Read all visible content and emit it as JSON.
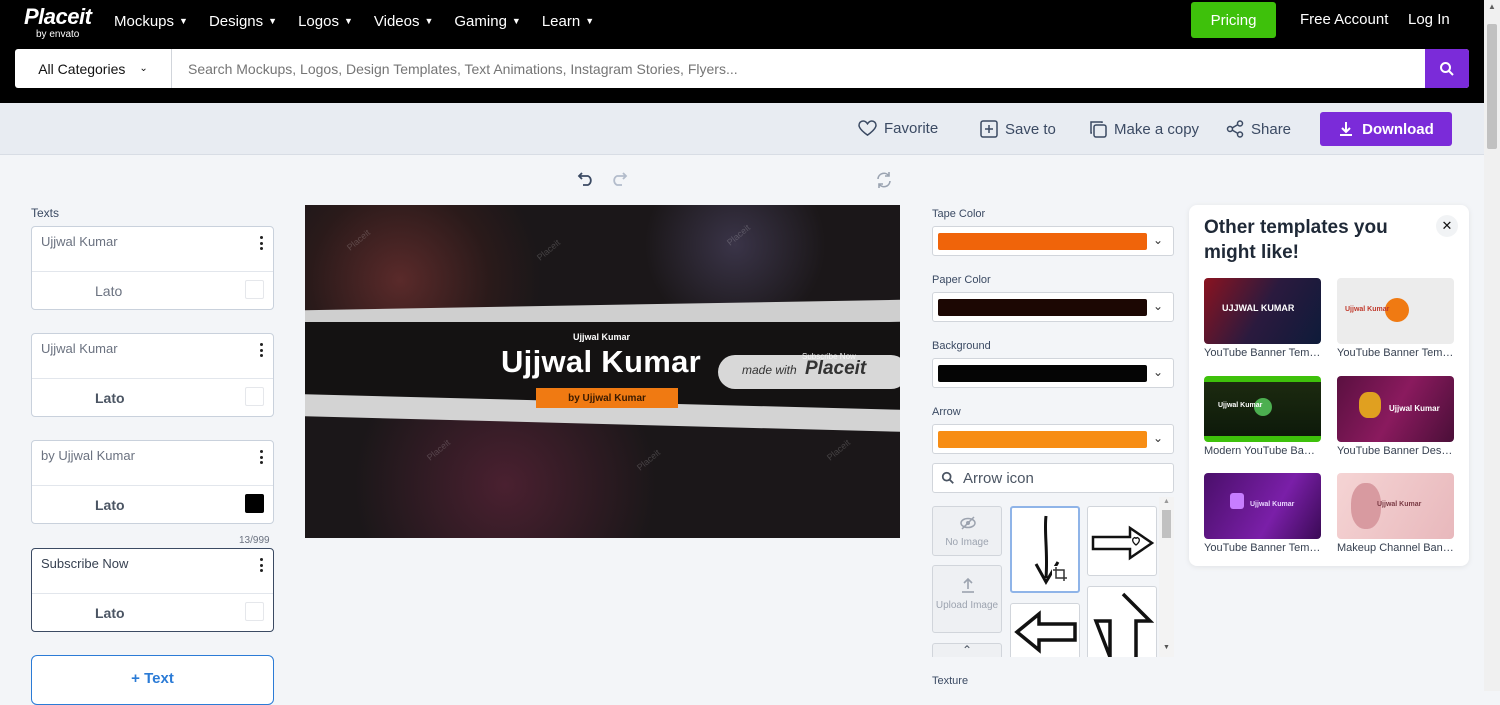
{
  "brand": {
    "name": "Placeit",
    "sub": "by envato"
  },
  "nav": [
    {
      "label": "Mockups"
    },
    {
      "label": "Designs"
    },
    {
      "label": "Logos"
    },
    {
      "label": "Videos"
    },
    {
      "label": "Gaming"
    },
    {
      "label": "Learn"
    }
  ],
  "header": {
    "pricing": "Pricing",
    "free_account": "Free Account",
    "login": "Log In"
  },
  "search": {
    "category": "All Categories",
    "placeholder": "Search Mockups, Logos, Design Templates, Text Animations, Instagram Stories, Flyers..."
  },
  "toolbar": {
    "favorite": "Favorite",
    "save_to": "Save to",
    "make_copy": "Make a copy",
    "share": "Share",
    "download": "Download"
  },
  "texts_panel": {
    "label": "Texts",
    "items": [
      {
        "value": "Ujjwal Kumar",
        "font": "Lato"
      },
      {
        "value": "Ujjwal Kumar",
        "font": "Lato"
      },
      {
        "value": "by Ujjwal Kumar",
        "font": "Lato"
      },
      {
        "value": "Subscribe Now",
        "font": "Lato"
      }
    ],
    "char_count": "13/999",
    "add_text": "+ Text"
  },
  "canvas": {
    "small_title": "Ujjwal Kumar",
    "big_title": "Ujjwal Kumar",
    "tape_text": "by Ujjwal Kumar",
    "subscribe": "Subscribe Now",
    "made_with": "made with",
    "placeit": "Placeit",
    "watermark": "Placeit"
  },
  "options": {
    "tape_color": {
      "label": "Tape Color",
      "color": "#f0640a"
    },
    "paper_color": {
      "label": "Paper Color",
      "color": "#1c0703"
    },
    "background": {
      "label": "Background",
      "color": "#050505"
    },
    "arrow": {
      "label": "Arrow",
      "color": "#f78d14"
    },
    "icon_search": {
      "value": "Arrow icon"
    },
    "tiles": {
      "no_image": "No Image",
      "upload_image": "Upload Image"
    },
    "texture_label": "Texture"
  },
  "templates": {
    "title": "Other templates you might like!",
    "items": [
      {
        "caption": "YouTube Banner Template...",
        "thumb_text": "UJJWAL KUMAR"
      },
      {
        "caption": "YouTube Banner Template...",
        "thumb_text": "Ujjwal Kumar"
      },
      {
        "caption": "Modern YouTube Banner...",
        "thumb_text": "Ujjwal Kumar"
      },
      {
        "caption": "YouTube Banner Design...",
        "thumb_text": "Ujjwal Kumar"
      },
      {
        "caption": "YouTube Banner Template...",
        "thumb_text": "Ujjwal Kumar"
      },
      {
        "caption": "Makeup Channel Banner...",
        "thumb_text": "Ujjwal Kumar"
      }
    ]
  }
}
